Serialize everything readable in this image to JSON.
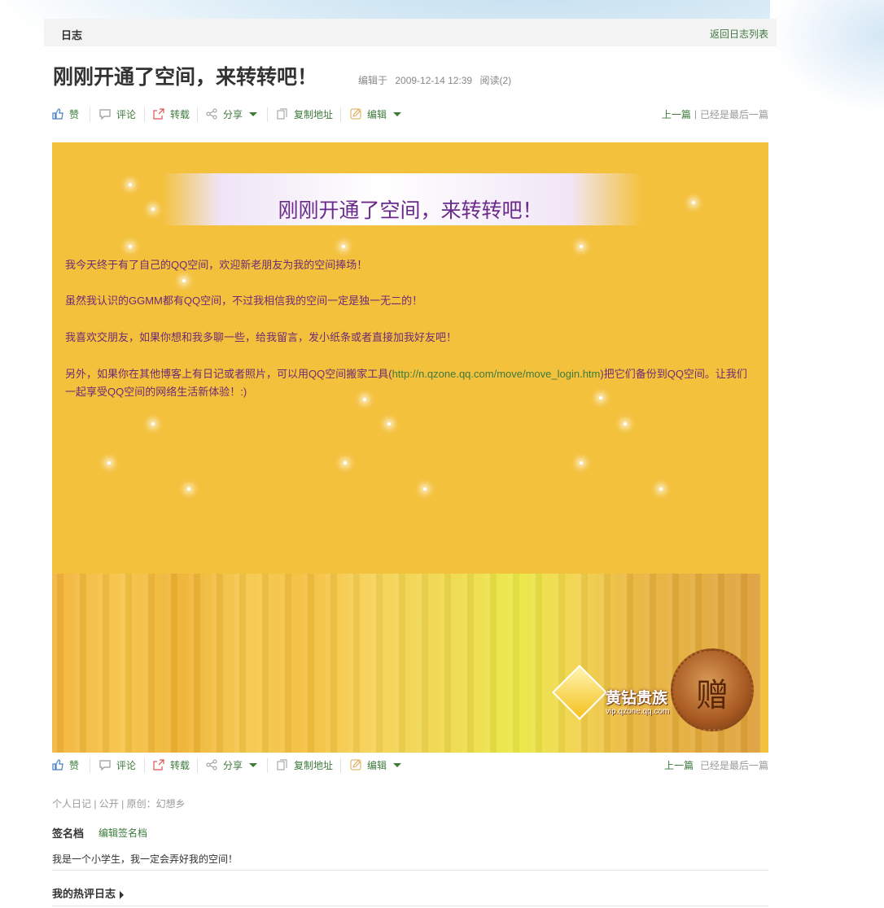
{
  "topbar": {
    "title": "日志",
    "back_link": "返回日志列表"
  },
  "post": {
    "title": "刚刚开通了空间，来转转吧！",
    "edited_label": "编辑于",
    "edited_time": "2009-12-14 12:39",
    "read_label": "阅读(2)"
  },
  "toolbar": {
    "like": "赞",
    "comment": "评论",
    "repost": "转载",
    "share": "分享",
    "copy_address": "复制地址",
    "edit": "编辑",
    "prev": "上一篇",
    "separator": "|",
    "last": "已经是最后一篇"
  },
  "card": {
    "banner_title": "刚刚开通了空间，来转转吧！",
    "p1": "我今天终于有了自己的QQ空间，欢迎新老朋友为我的空间捧场！",
    "p2": "虽然我认识的GGMM都有QQ空间，不过我相信我的空间一定是独一无二的！",
    "p3": "我喜欢交朋友，如果你想和我多聊一些，给我留言，发小纸条或者直接加我好友吧！",
    "p4_before": "另外，如果你在其他博客上有日记或者照片，可以用QQ空间搬家工具(",
    "p4_link": "http://n.qzone.qq.com/move/move_login.htm",
    "p4_after": ")把它们备份到QQ空间。让我们一起享受QQ空间的网络生活新体验！:)",
    "badge_name": "黄钻贵族",
    "badge_url": "vip.qzone.qq.com",
    "seal_char": "赠"
  },
  "footer": {
    "info": "个人日记 | 公开 | 原创：幻想乡",
    "sig_title": "签名档",
    "sig_edit": "编辑签名档",
    "sig_text": "我是一个小学生，我一定会弄好我的空间！",
    "hot_title": "我的热评日志"
  },
  "colors": {
    "link": "#3c7a3c",
    "card_bg": "#f4c13c",
    "card_text": "#6e2a77"
  }
}
